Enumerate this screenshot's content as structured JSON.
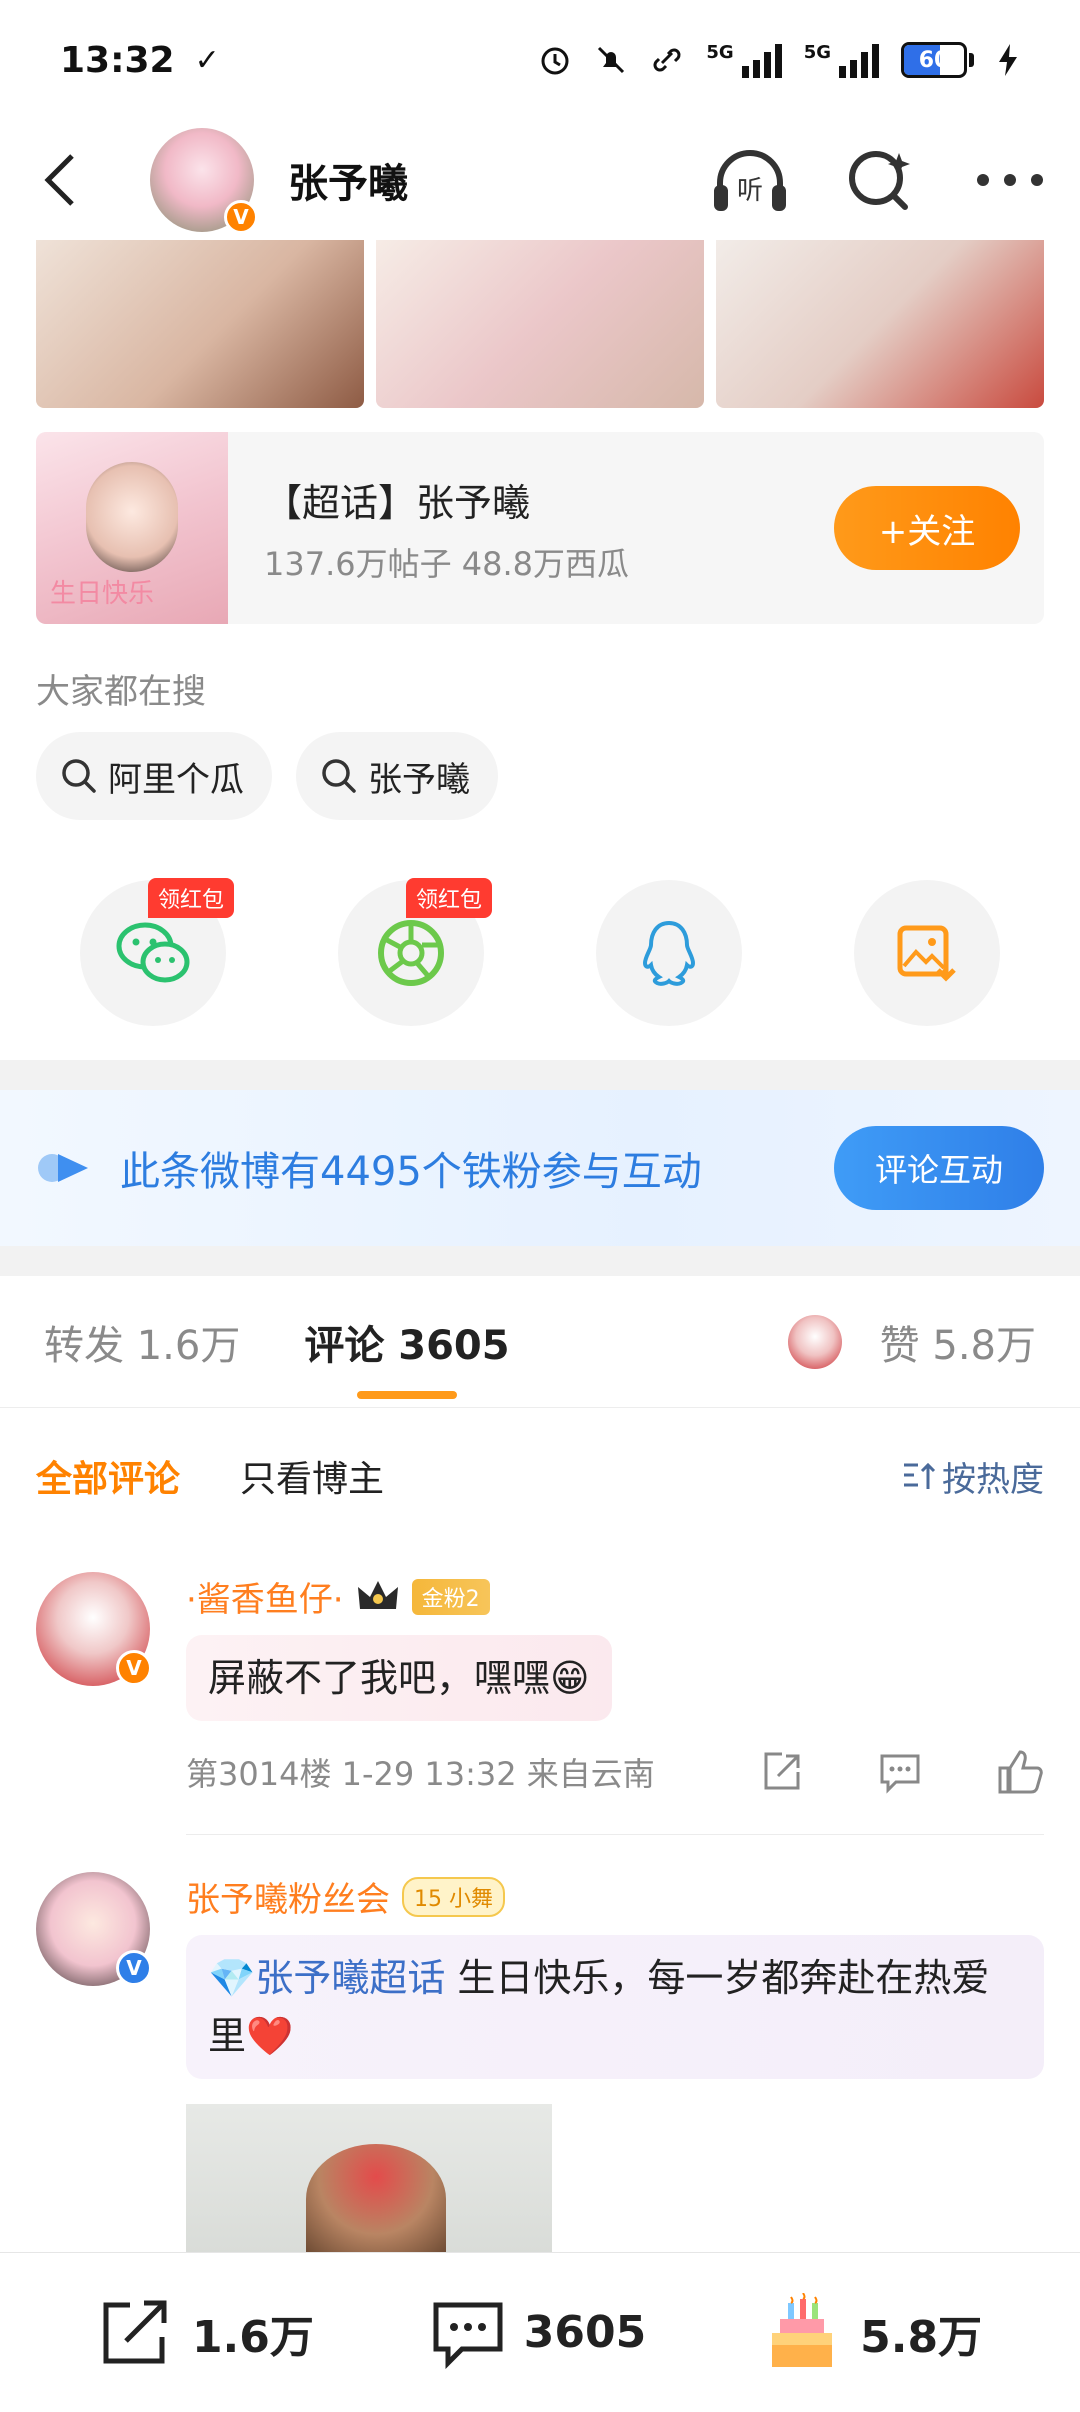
{
  "status_bar": {
    "time": "13:32",
    "check": "✓",
    "network1": "5G",
    "network2": "5G",
    "battery": "60",
    "battery_level": 0.6
  },
  "header": {
    "name": "张予曦",
    "avatar_badge": "V",
    "listen_label": "听"
  },
  "super_topic": {
    "title": "【超话】张予曦",
    "stats": "137.6万帖子 48.8万西瓜",
    "follow_label": "+关注",
    "cover_text": "生日快乐"
  },
  "search": {
    "heading": "大家都在搜",
    "chips": [
      "阿里个瓜",
      "张予曦"
    ]
  },
  "share": {
    "red_packet_label": "领红包"
  },
  "fans_banner": {
    "text": "此条微博有4495个铁粉参与互动",
    "button": "评论互动"
  },
  "tabs": {
    "repost": "转发 1.6万",
    "comments": "评论 3605",
    "likes": "赞 5.8万"
  },
  "filter": {
    "all": "全部评论",
    "author_only": "只看博主",
    "sort": "按热度"
  },
  "comments": [
    {
      "name": "·酱香鱼仔·",
      "badge": "金粉2",
      "text": "屏蔽不了我吧，嘿嘿😁",
      "meta": "第3014楼 1-29 13:32  来自云南",
      "avatar_badge": "V"
    },
    {
      "name": "张予曦粉丝会",
      "badge": "15 小舞",
      "topic": "💎张予曦超话",
      "text": " 生日快乐，每一岁都奔赴在热爱里❤️",
      "avatar_badge": "V"
    }
  ],
  "bottom_bar": {
    "repost_count": "1.6万",
    "comment_count": "3605",
    "like_count": "5.8万"
  },
  "colors": {
    "accent": "#ff8200",
    "link": "#2d7de0"
  }
}
